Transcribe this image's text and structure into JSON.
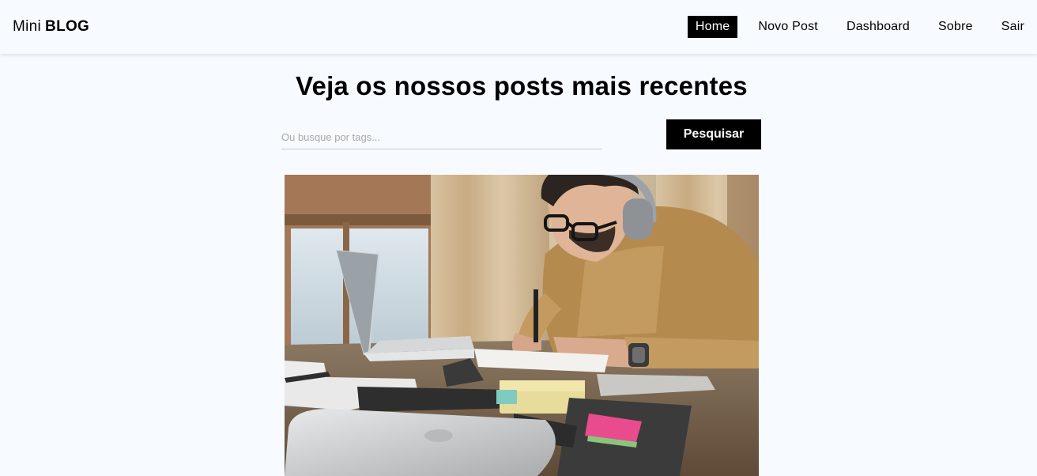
{
  "brand": {
    "light": "Mini",
    "bold": "BLOG"
  },
  "nav": {
    "items": [
      {
        "label": "Home",
        "active": true
      },
      {
        "label": "Novo Post",
        "active": false
      },
      {
        "label": "Dashboard",
        "active": false
      },
      {
        "label": "Sobre",
        "active": false
      },
      {
        "label": "Sair",
        "active": false
      }
    ]
  },
  "main": {
    "title": "Veja os nossos posts mais recentes",
    "search": {
      "placeholder": "Ou busque por tags...",
      "value": "",
      "button_label": "Pesquisar"
    }
  },
  "post": {
    "image_subject": "man-writing-at-desk-with-laptop"
  }
}
